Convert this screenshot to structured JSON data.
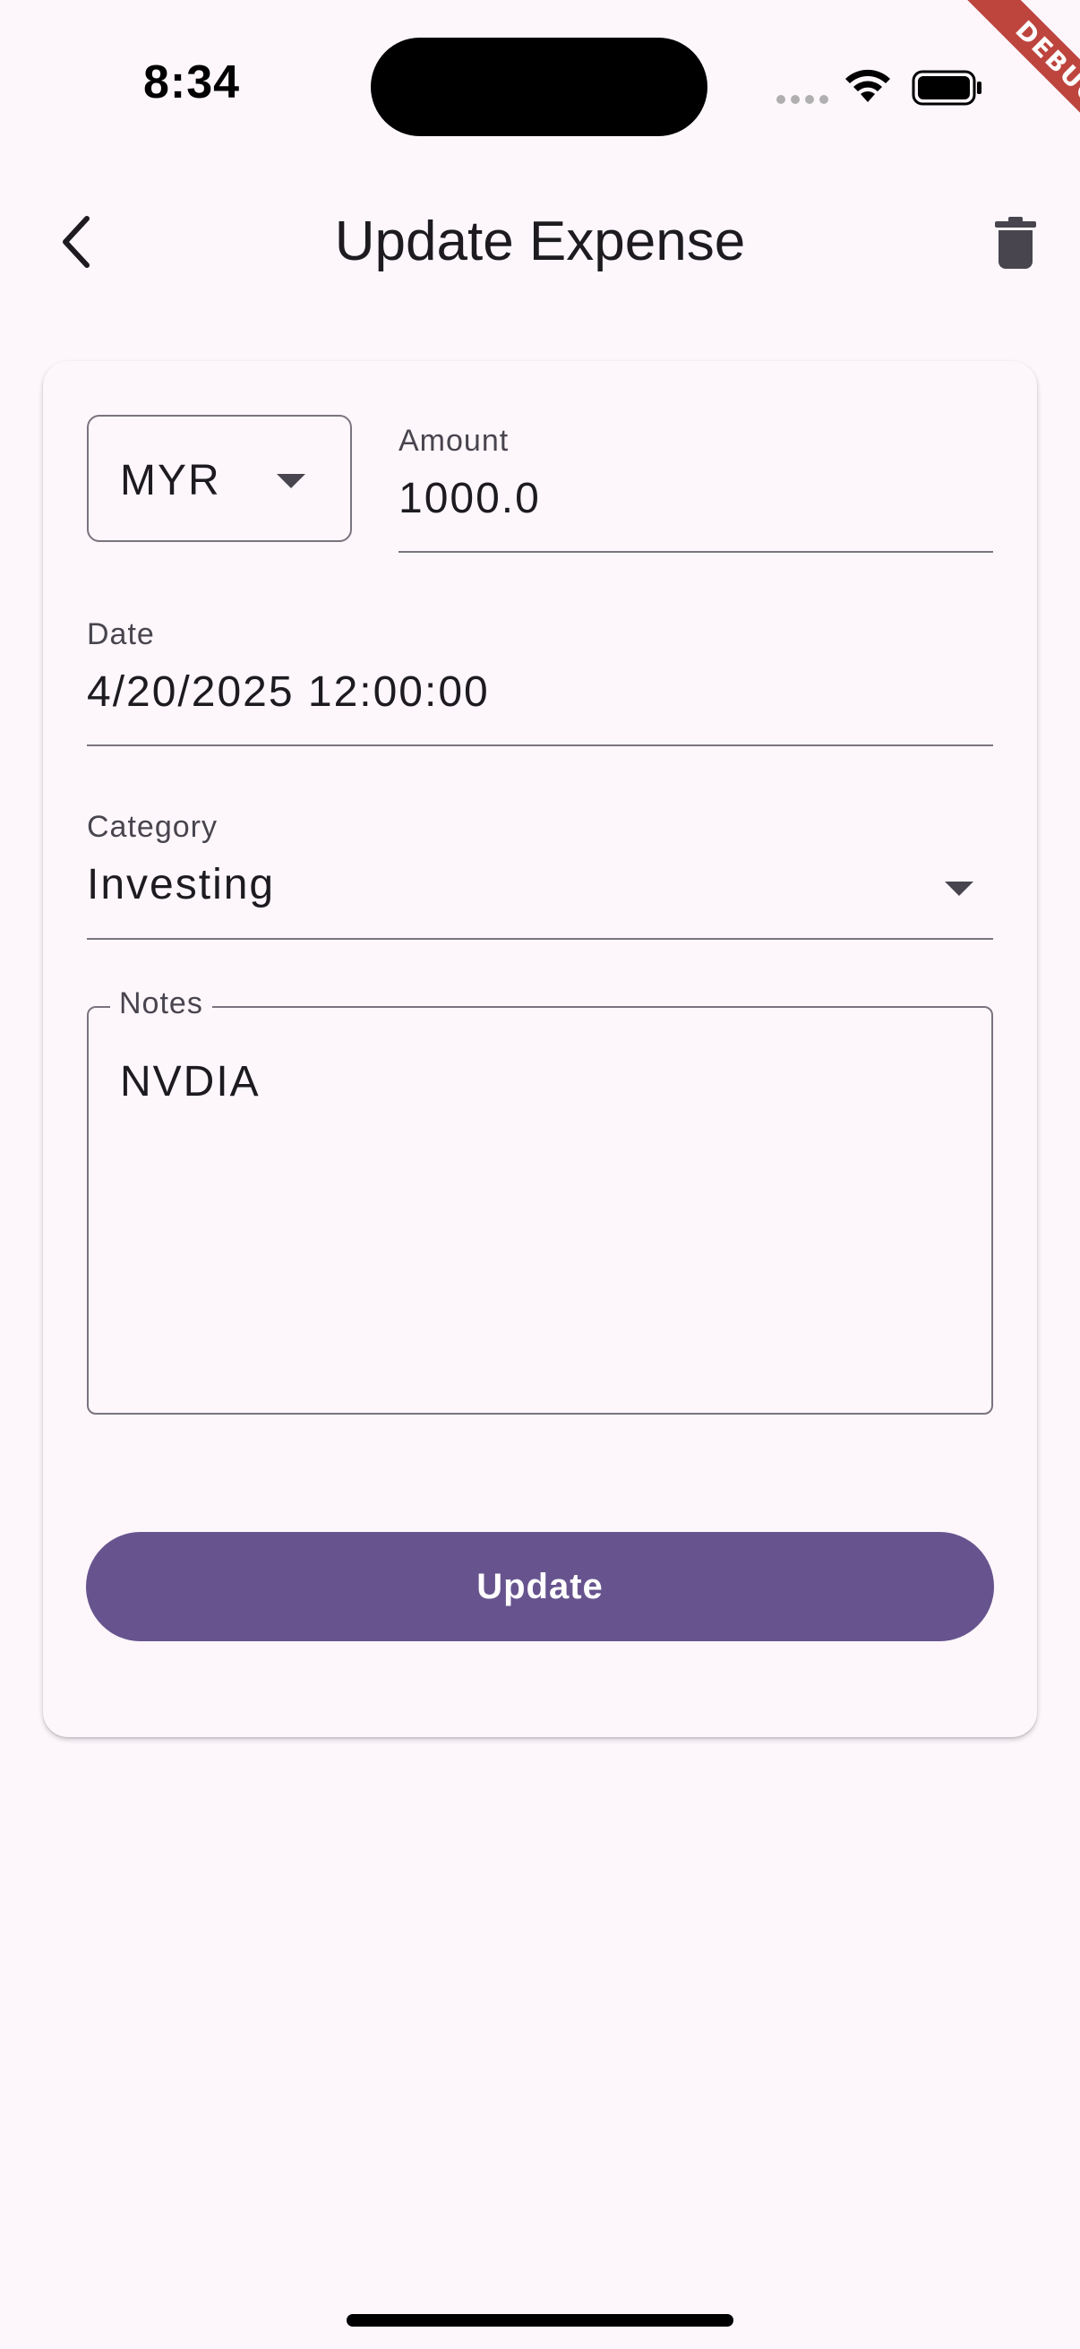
{
  "status_bar": {
    "time": "8:34",
    "icons": [
      "signal-dots-icon",
      "wifi-icon",
      "battery-icon"
    ]
  },
  "debug_banner": "DEBUG",
  "app_bar": {
    "title": "Update Expense",
    "back_icon": "chevron-left-icon",
    "delete_icon": "trash-icon"
  },
  "form": {
    "currency": {
      "value": "MYR"
    },
    "amount": {
      "label": "Amount",
      "value": "1000.0"
    },
    "date": {
      "label": "Date",
      "value": "4/20/2025 12:00:00"
    },
    "category": {
      "label": "Category",
      "value": "Investing"
    },
    "notes": {
      "label": "Notes",
      "value": "NVDIA"
    },
    "submit_label": "Update"
  },
  "colors": {
    "background": "#fdf7fc",
    "primary": "#67548e",
    "outline": "#79747e",
    "debug": "#b3261e"
  }
}
